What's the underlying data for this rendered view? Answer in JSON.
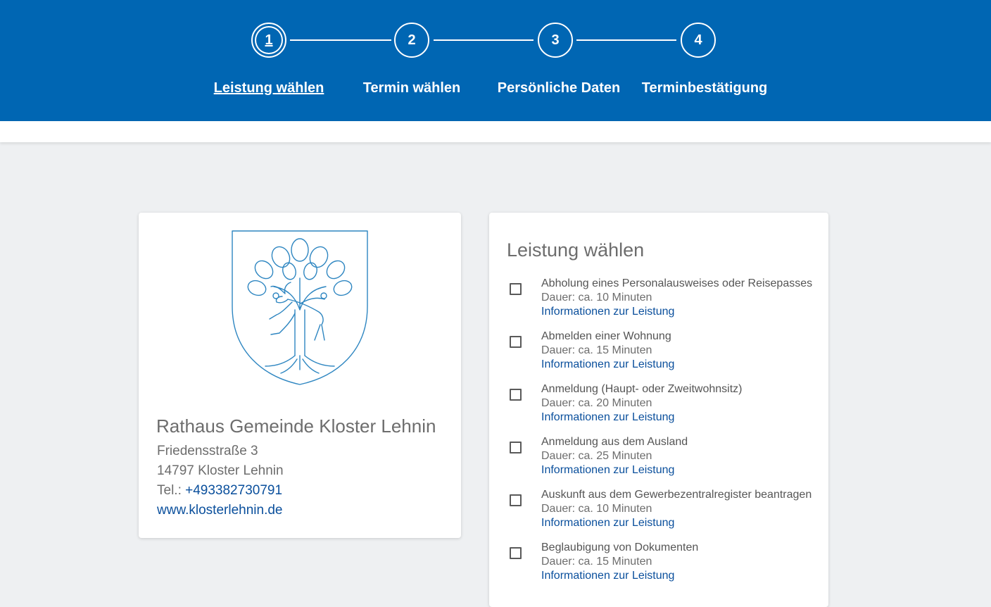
{
  "steps": [
    {
      "number": "1",
      "label": "Leistung wählen",
      "active": true
    },
    {
      "number": "2",
      "label": "Termin wählen",
      "active": false
    },
    {
      "number": "3",
      "label": "Persönliche Daten",
      "active": false
    },
    {
      "number": "4",
      "label": "Terminbestätigung",
      "active": false
    }
  ],
  "location": {
    "name": "Rathaus Gemeinde Kloster Lehnin",
    "street": "Friedensstraße 3",
    "city": "14797 Kloster Lehnin",
    "tel_label": "Tel.: ",
    "phone": "+493382730791",
    "website": "www.klosterlehnin.de"
  },
  "services": {
    "title": "Leistung wählen",
    "items": [
      {
        "name": "Abholung eines Personalausweises oder Reisepasses",
        "duration": "Dauer: ca. 10 Minuten",
        "info": "Informationen zur Leistung"
      },
      {
        "name": "Abmelden einer Wohnung",
        "duration": "Dauer: ca. 15 Minuten",
        "info": "Informationen zur Leistung"
      },
      {
        "name": "Anmeldung (Haupt- oder Zweitwohnsitz)",
        "duration": "Dauer: ca. 20 Minuten",
        "info": "Informationen zur Leistung"
      },
      {
        "name": "Anmeldung aus dem Ausland",
        "duration": "Dauer: ca. 25 Minuten",
        "info": "Informationen zur Leistung"
      },
      {
        "name": "Auskunft aus dem Gewerbezentralregister beantragen",
        "duration": "Dauer: ca. 10 Minuten",
        "info": "Informationen zur Leistung"
      },
      {
        "name": "Beglaubigung von Dokumenten",
        "duration": "Dauer: ca. 15 Minuten",
        "info": "Informationen zur Leistung"
      }
    ]
  },
  "colors": {
    "primary": "#0066b3",
    "link": "#0a4f9c",
    "background": "#eef0f2"
  },
  "icons": {
    "crest": "coat-of-arms-icon",
    "checkbox": "checkbox-icon"
  }
}
